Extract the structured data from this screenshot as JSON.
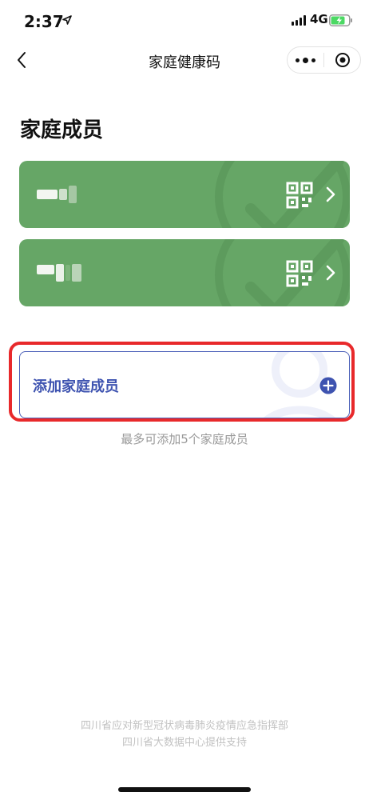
{
  "status_bar": {
    "time": "2:37",
    "network": "4G",
    "icons": [
      "location-arrow-icon",
      "signal-icon",
      "battery-charging-icon"
    ],
    "battery_color": "#4cd964"
  },
  "nav": {
    "title": "家庭健康码",
    "icons": [
      "back-chevron-icon",
      "more-dots-icon",
      "close-target-icon"
    ]
  },
  "section_title": "家庭成员",
  "members": [
    {
      "name_redacted": true,
      "icons": [
        "qr-code-icon",
        "chevron-right-icon"
      ]
    },
    {
      "name_redacted": true,
      "icons": [
        "qr-code-icon",
        "chevron-right-icon"
      ]
    }
  ],
  "add_member": {
    "label": "添加家庭成员",
    "icon": "plus-circle-icon"
  },
  "limit_hint": "最多可添加5个家庭成员",
  "footer": {
    "line1": "四川省应对新型冠状病毒肺炎疫情应急指挥部",
    "line2": "四川省大数据中心提供支持"
  },
  "colors": {
    "card_green": "#66a666",
    "accent_blue": "#3e53b0",
    "highlight_red": "#e8292b"
  }
}
